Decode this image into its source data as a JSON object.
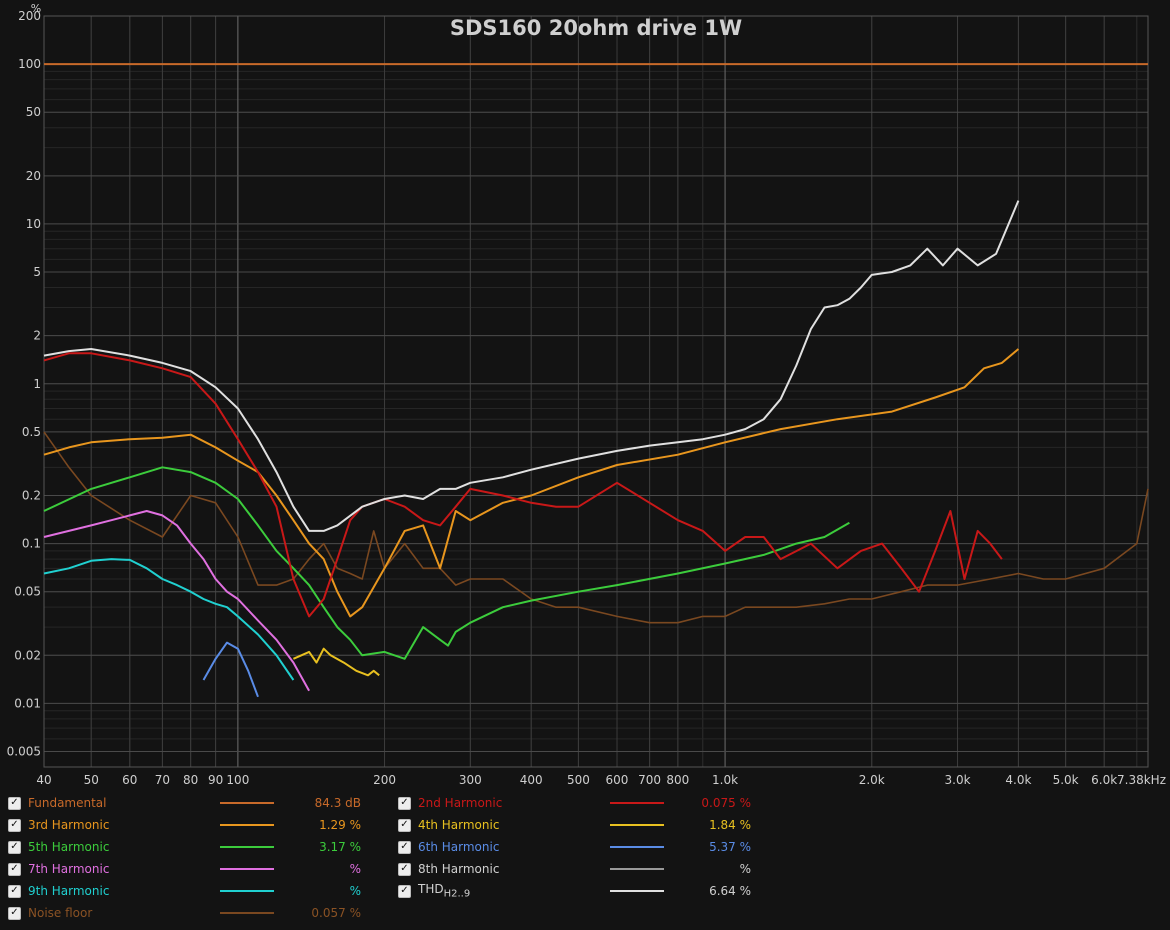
{
  "chart_data": {
    "type": "line",
    "title": "SDS160 20ohm drive 1W",
    "y_unit_label": "%",
    "x_scale": "log",
    "y_scale": "log",
    "xlim": [
      40,
      7380
    ],
    "ylim": [
      0.004,
      200
    ],
    "grid": true,
    "x_ticks": [
      {
        "v": 40,
        "label": "40"
      },
      {
        "v": 50,
        "label": "50"
      },
      {
        "v": 60,
        "label": "60"
      },
      {
        "v": 70,
        "label": "70"
      },
      {
        "v": 80,
        "label": "80"
      },
      {
        "v": 90,
        "label": "90"
      },
      {
        "v": 100,
        "label": "100"
      },
      {
        "v": 200,
        "label": "200"
      },
      {
        "v": 300,
        "label": "300"
      },
      {
        "v": 400,
        "label": "400"
      },
      {
        "v": 500,
        "label": "500"
      },
      {
        "v": 600,
        "label": "600"
      },
      {
        "v": 700,
        "label": "700"
      },
      {
        "v": 800,
        "label": "800"
      },
      {
        "v": 1000,
        "label": "1.0k"
      },
      {
        "v": 2000,
        "label": "2.0k"
      },
      {
        "v": 3000,
        "label": "3.0k"
      },
      {
        "v": 4000,
        "label": "4.0k"
      },
      {
        "v": 5000,
        "label": "5.0k"
      },
      {
        "v": 6000,
        "label": "6.0k"
      },
      {
        "v": 7380,
        "label": "7.38kHz"
      }
    ],
    "y_ticks": [
      {
        "v": 200,
        "label": "200"
      },
      {
        "v": 100,
        "label": "100"
      },
      {
        "v": 50,
        "label": "50"
      },
      {
        "v": 20,
        "label": "20"
      },
      {
        "v": 10,
        "label": "10"
      },
      {
        "v": 5,
        "label": "5"
      },
      {
        "v": 2,
        "label": "2"
      },
      {
        "v": 1,
        "label": "1"
      },
      {
        "v": 0.5,
        "label": "0.5"
      },
      {
        "v": 0.2,
        "label": "0.2"
      },
      {
        "v": 0.1,
        "label": "0.1"
      },
      {
        "v": 0.05,
        "label": "0.05"
      },
      {
        "v": 0.02,
        "label": "0.02"
      },
      {
        "v": 0.01,
        "label": "0.01"
      },
      {
        "v": 0.005,
        "label": "0.005"
      }
    ],
    "series": [
      {
        "name": "Fundamental",
        "color": "#c86a2a",
        "value": "84.3 dB",
        "x": [
          40,
          7380
        ],
        "y": [
          100,
          100
        ]
      },
      {
        "name": "2nd Harmonic",
        "color": "#c81818",
        "value": "0.075 %",
        "x": [
          40,
          45,
          50,
          60,
          70,
          80,
          90,
          100,
          110,
          120,
          130,
          140,
          150,
          160,
          170,
          180,
          200,
          220,
          240,
          260,
          280,
          300,
          350,
          400,
          450,
          500,
          600,
          700,
          800,
          900,
          1000,
          1100,
          1200,
          1300,
          1500,
          1700,
          1900,
          2100,
          2300,
          2500,
          2700,
          2900,
          3100,
          3300,
          3500,
          3700
        ],
        "y": [
          1.4,
          1.55,
          1.55,
          1.4,
          1.25,
          1.1,
          0.75,
          0.45,
          0.28,
          0.17,
          0.06,
          0.035,
          0.045,
          0.08,
          0.14,
          0.17,
          0.19,
          0.17,
          0.14,
          0.13,
          0.17,
          0.22,
          0.2,
          0.18,
          0.17,
          0.17,
          0.24,
          0.18,
          0.14,
          0.12,
          0.09,
          0.11,
          0.11,
          0.08,
          0.1,
          0.07,
          0.09,
          0.1,
          0.07,
          0.05,
          0.09,
          0.16,
          0.06,
          0.12,
          0.1,
          0.08
        ]
      },
      {
        "name": "3rd Harmonic",
        "color": "#e8961e",
        "value": "1.29 %",
        "x": [
          40,
          45,
          50,
          60,
          70,
          80,
          90,
          100,
          110,
          120,
          130,
          140,
          150,
          160,
          170,
          180,
          200,
          220,
          240,
          260,
          280,
          300,
          350,
          400,
          500,
          600,
          800,
          1000,
          1300,
          1700,
          2200,
          2700,
          3100,
          3400,
          3700,
          4000
        ],
        "y": [
          0.36,
          0.4,
          0.43,
          0.45,
          0.46,
          0.48,
          0.4,
          0.33,
          0.28,
          0.2,
          0.14,
          0.1,
          0.08,
          0.05,
          0.035,
          0.04,
          0.07,
          0.12,
          0.13,
          0.07,
          0.16,
          0.14,
          0.18,
          0.2,
          0.26,
          0.31,
          0.36,
          0.43,
          0.52,
          0.6,
          0.67,
          0.82,
          0.95,
          1.25,
          1.35,
          1.65
        ]
      },
      {
        "name": "4th Harmonic",
        "color": "#e8c020",
        "value": "1.84 %",
        "x": [
          130,
          140,
          145,
          150,
          155,
          165,
          175,
          185,
          190,
          195
        ],
        "y": [
          0.019,
          0.021,
          0.018,
          0.022,
          0.02,
          0.018,
          0.016,
          0.015,
          0.016,
          0.015
        ]
      },
      {
        "name": "5th Harmonic",
        "color": "#3ccc3c",
        "value": "3.17 %",
        "x": [
          40,
          50,
          60,
          70,
          80,
          90,
          100,
          110,
          120,
          130,
          140,
          150,
          160,
          170,
          180,
          200,
          220,
          240,
          260,
          270,
          280,
          300,
          350,
          400,
          500,
          600,
          800,
          1000,
          1200,
          1400,
          1600,
          1800
        ],
        "y": [
          0.16,
          0.22,
          0.26,
          0.3,
          0.28,
          0.24,
          0.19,
          0.13,
          0.09,
          0.07,
          0.055,
          0.04,
          0.03,
          0.025,
          0.02,
          0.021,
          0.019,
          0.03,
          0.025,
          0.023,
          0.028,
          0.032,
          0.04,
          0.044,
          0.05,
          0.055,
          0.065,
          0.075,
          0.085,
          0.1,
          0.11,
          0.135
        ]
      },
      {
        "name": "6th Harmonic",
        "color": "#5a8ce6",
        "value": "5.37 %",
        "x": [
          85,
          90,
          95,
          100,
          105,
          110
        ],
        "y": [
          0.014,
          0.019,
          0.024,
          0.022,
          0.016,
          0.011
        ]
      },
      {
        "name": "7th Harmonic",
        "color": "#e070e0",
        "value": "",
        "x": [
          40,
          45,
          50,
          55,
          60,
          65,
          70,
          75,
          80,
          85,
          90,
          95,
          100,
          110,
          120,
          130,
          140
        ],
        "y": [
          0.11,
          0.12,
          0.13,
          0.14,
          0.15,
          0.16,
          0.15,
          0.13,
          0.1,
          0.08,
          0.06,
          0.05,
          0.045,
          0.033,
          0.025,
          0.018,
          0.012
        ]
      },
      {
        "name": "8th Harmonic",
        "color": "#9a9a9a",
        "value": "",
        "x": [],
        "y": []
      },
      {
        "name": "9th Harmonic",
        "color": "#20d0d0",
        "value": "",
        "x": [
          40,
          45,
          50,
          55,
          60,
          65,
          70,
          75,
          80,
          85,
          90,
          95,
          100,
          110,
          120,
          130
        ],
        "y": [
          0.065,
          0.07,
          0.078,
          0.08,
          0.079,
          0.07,
          0.06,
          0.055,
          0.05,
          0.045,
          0.042,
          0.04,
          0.035,
          0.027,
          0.02,
          0.014
        ]
      },
      {
        "name": "THD",
        "sub": "H2..9",
        "color": "#e0e0e0",
        "value": "6.64 %",
        "x": [
          40,
          45,
          50,
          60,
          70,
          80,
          90,
          100,
          110,
          120,
          130,
          140,
          150,
          160,
          180,
          200,
          220,
          240,
          260,
          280,
          300,
          350,
          400,
          500,
          600,
          700,
          800,
          900,
          1000,
          1100,
          1200,
          1300,
          1400,
          1500,
          1600,
          1700,
          1800,
          1900,
          2000,
          2200,
          2400,
          2600,
          2800,
          3000,
          3300,
          3600,
          4000
        ],
        "y": [
          1.5,
          1.6,
          1.65,
          1.5,
          1.35,
          1.2,
          0.95,
          0.7,
          0.45,
          0.28,
          0.17,
          0.12,
          0.12,
          0.13,
          0.17,
          0.19,
          0.2,
          0.19,
          0.22,
          0.22,
          0.24,
          0.26,
          0.29,
          0.34,
          0.38,
          0.41,
          0.43,
          0.45,
          0.48,
          0.52,
          0.6,
          0.8,
          1.3,
          2.2,
          3.0,
          3.1,
          3.4,
          4.0,
          4.8,
          5.0,
          5.5,
          7.0,
          5.5,
          7.0,
          5.5,
          6.5,
          14
        ]
      },
      {
        "name": "Noise floor",
        "color": "#7a4820",
        "value": "0.057 %",
        "x": [
          40,
          45,
          50,
          60,
          70,
          80,
          90,
          100,
          110,
          120,
          130,
          140,
          150,
          160,
          170,
          180,
          190,
          200,
          220,
          240,
          260,
          280,
          300,
          350,
          400,
          450,
          500,
          600,
          700,
          800,
          900,
          1000,
          1100,
          1200,
          1400,
          1600,
          1800,
          2000,
          2300,
          2600,
          3000,
          3500,
          4000,
          4500,
          5000,
          6000,
          7000,
          7380
        ],
        "y": [
          0.5,
          0.3,
          0.2,
          0.14,
          0.11,
          0.2,
          0.18,
          0.11,
          0.055,
          0.055,
          0.06,
          0.08,
          0.1,
          0.07,
          0.065,
          0.06,
          0.12,
          0.07,
          0.1,
          0.07,
          0.07,
          0.055,
          0.06,
          0.06,
          0.045,
          0.04,
          0.04,
          0.035,
          0.032,
          0.032,
          0.035,
          0.035,
          0.04,
          0.04,
          0.04,
          0.042,
          0.045,
          0.045,
          0.05,
          0.055,
          0.055,
          0.06,
          0.065,
          0.06,
          0.06,
          0.07,
          0.1,
          0.22
        ]
      }
    ]
  },
  "legend": {
    "rows": [
      {
        "name": "Fundamental",
        "value": "84.3 dB",
        "color": "#c86a2a"
      },
      {
        "name": "2nd Harmonic",
        "value": "0.075 %",
        "color": "#c81818"
      },
      {
        "name": "3rd Harmonic",
        "value": "1.29 %",
        "color": "#e8961e"
      },
      {
        "name": "4th Harmonic",
        "value": "1.84 %",
        "color": "#e8c020"
      },
      {
        "name": "5th Harmonic",
        "value": "3.17 %",
        "color": "#3ccc3c"
      },
      {
        "name": "6th Harmonic",
        "value": "5.37 %",
        "color": "#5a8ce6"
      },
      {
        "name": "7th Harmonic",
        "value": "%",
        "color": "#e070e0"
      },
      {
        "name": "8th Harmonic",
        "value": "%",
        "color": "#9a9a9a"
      },
      {
        "name": "9th Harmonic",
        "value": "%",
        "color": "#20d0d0"
      },
      {
        "name": "THD",
        "sub": "H2..9",
        "value": "6.64 %",
        "color": "#e0e0e0"
      },
      {
        "name": "Noise floor",
        "value": "0.057 %",
        "color": "#7a4820"
      }
    ],
    "checkbox_glyph": "✓"
  },
  "colors": {
    "background": "#131313",
    "grid_major": "#5a5a5a",
    "grid_minor": "#2e2e2e",
    "text": "#d0d0d0"
  }
}
